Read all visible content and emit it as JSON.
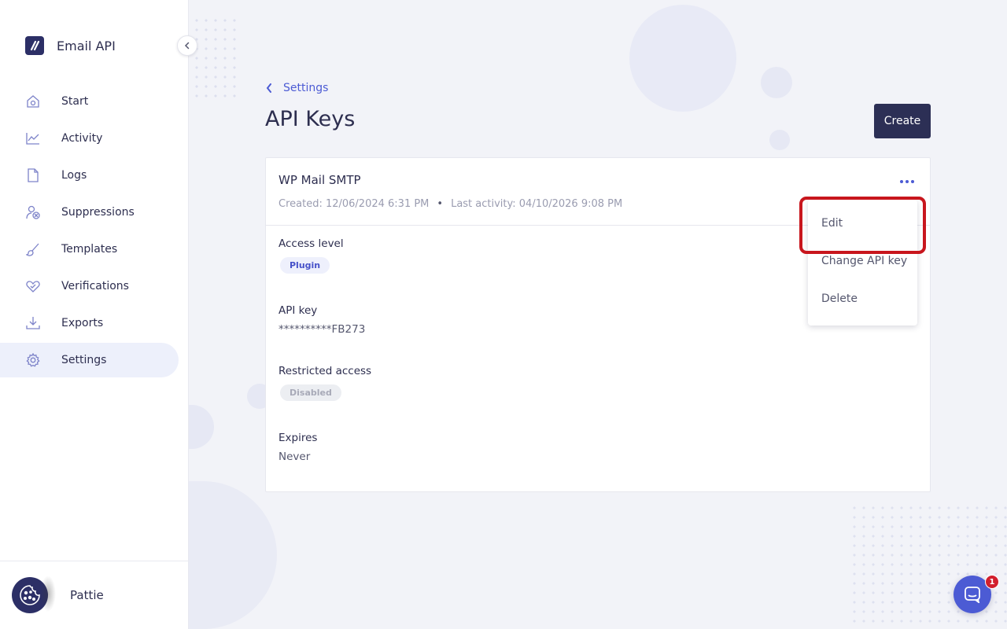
{
  "brand": {
    "name": "Email API",
    "logo_icon": "stripes-logo-icon"
  },
  "sidebar": {
    "collapse_icon": "chevron-left-icon",
    "items": [
      {
        "label": "Start",
        "icon": "home-icon",
        "active": false
      },
      {
        "label": "Activity",
        "icon": "chart-line-icon",
        "active": false
      },
      {
        "label": "Logs",
        "icon": "file-icon",
        "active": false
      },
      {
        "label": "Suppressions",
        "icon": "user-x-icon",
        "active": false
      },
      {
        "label": "Templates",
        "icon": "brush-icon",
        "active": false
      },
      {
        "label": "Verifications",
        "icon": "heart-check-icon",
        "active": false
      },
      {
        "label": "Exports",
        "icon": "download-icon",
        "active": false
      },
      {
        "label": "Settings",
        "icon": "gear-icon",
        "active": true
      }
    ]
  },
  "user": {
    "name": "Pattie",
    "avatar_icon": "cookie-avatar-icon"
  },
  "breadcrumb": {
    "label": "Settings"
  },
  "page": {
    "title": "API Keys",
    "create_label": "Create"
  },
  "api_key_card": {
    "name": "WP Mail SMTP",
    "created": "Created: 12/06/2024 6:31 PM",
    "separator": "•",
    "last_activity": "Last activity: 04/10/2026 9:08 PM",
    "access_level_label": "Access level",
    "access_level_value": "Plugin",
    "api_key_label": "API key",
    "api_key_value": "**********FB273",
    "restricted_label": "Restricted access",
    "restricted_value": "Disabled",
    "expires_label": "Expires",
    "expires_value": "Never"
  },
  "dropdown": {
    "items": [
      "Edit",
      "Change API key",
      "Delete"
    ]
  },
  "chat": {
    "badge_count": "1"
  },
  "colors": {
    "accent": "#4c5bd4",
    "navy": "#2c2f55",
    "highlight": "#c8161d",
    "background": "#f2f3f8"
  }
}
